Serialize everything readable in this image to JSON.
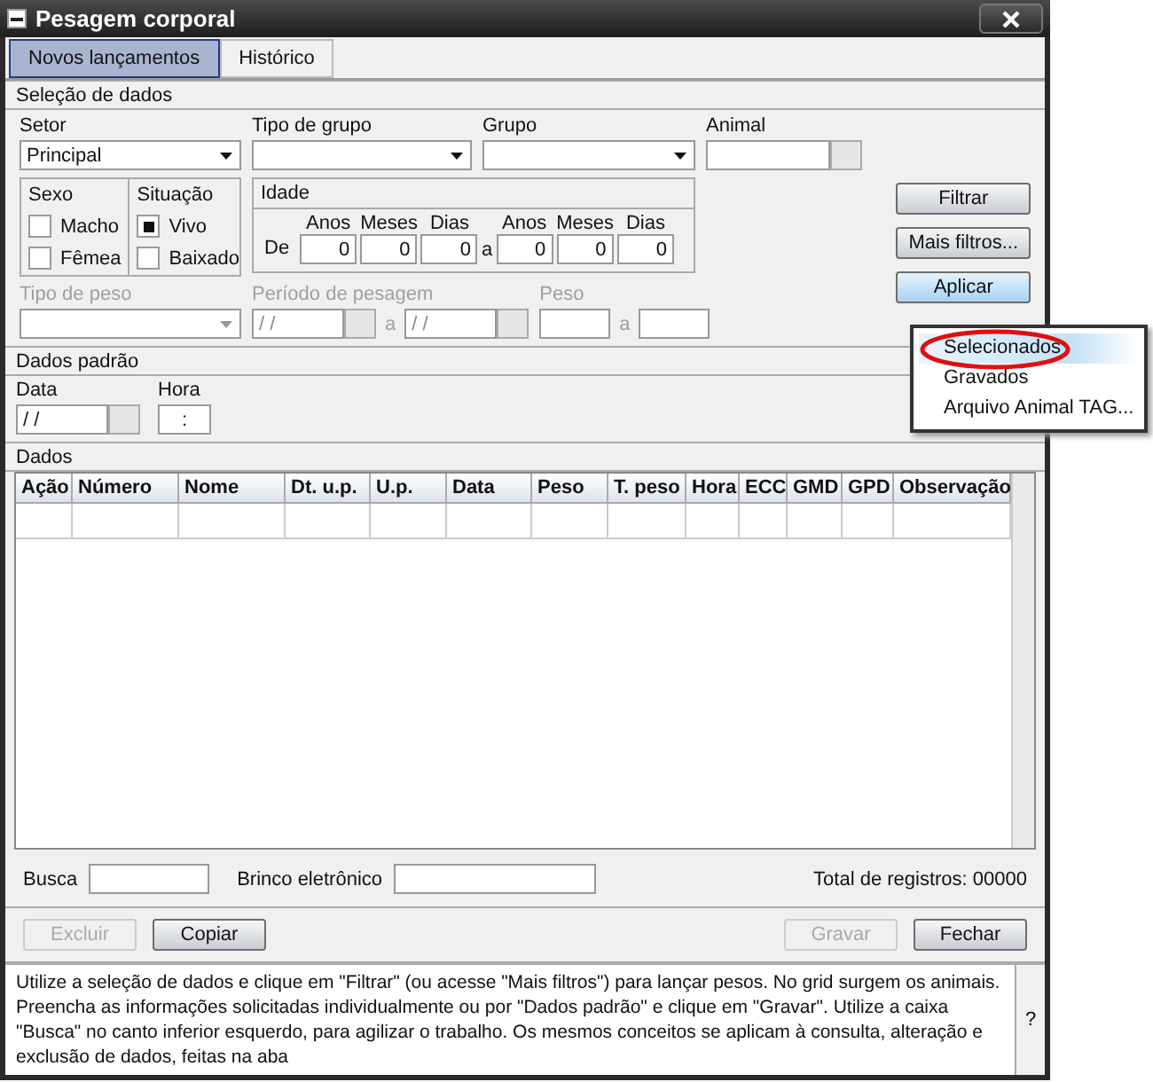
{
  "window": {
    "title": "Pesagem corporal"
  },
  "tabs": [
    {
      "label": "Novos lançamentos",
      "selected": true
    },
    {
      "label": "Histórico",
      "selected": false
    }
  ],
  "selection": {
    "title": "Seleção de dados",
    "setor": {
      "label": "Setor",
      "value": "Principal"
    },
    "tipo_grupo": {
      "label": "Tipo de grupo"
    },
    "grupo": {
      "label": "Grupo"
    },
    "animal": {
      "label": "Animal"
    },
    "sexo": {
      "title": "Sexo",
      "options": [
        {
          "label": "Macho",
          "checked": false
        },
        {
          "label": "Fêmea",
          "checked": false
        }
      ]
    },
    "situacao": {
      "title": "Situação",
      "options": [
        {
          "label": "Vivo",
          "checked": true
        },
        {
          "label": "Baixado",
          "checked": false
        }
      ]
    },
    "idade": {
      "title": "Idade",
      "from_label": "De",
      "to_label": "a",
      "from": [
        {
          "unit": "Anos",
          "value": "0"
        },
        {
          "unit": "Meses",
          "value": "0"
        },
        {
          "unit": "Dias",
          "value": "0"
        }
      ],
      "to": [
        {
          "unit": "Anos",
          "value": "0"
        },
        {
          "unit": "Meses",
          "value": "0"
        },
        {
          "unit": "Dias",
          "value": "0"
        }
      ]
    },
    "tipo_peso": {
      "label": "Tipo de peso",
      "disabled": true
    },
    "periodo": {
      "label": "Período de pesagem",
      "from": "/ /",
      "sep": "a",
      "to": "/ /",
      "disabled": true
    },
    "peso": {
      "label": "Peso",
      "sep": "a",
      "disabled": true
    }
  },
  "actions": [
    {
      "label": "Filtrar",
      "pressed": false
    },
    {
      "label": "Mais filtros...",
      "pressed": false
    },
    {
      "label": "Aplicar",
      "pressed": true
    }
  ],
  "menu": [
    {
      "label": "Selecionados",
      "selected": true
    },
    {
      "label": "Gravados",
      "selected": false
    },
    {
      "label": "Arquivo Animal TAG...",
      "selected": false
    }
  ],
  "dados_padrao": {
    "title": "Dados padrão",
    "data": {
      "label": "Data",
      "value": "/ /"
    },
    "hora": {
      "label": "Hora",
      "value": ":"
    }
  },
  "dados": {
    "title": "Dados",
    "columns": [
      "Ação",
      "Número",
      "Nome",
      "Dt. u.p.",
      "U.p.",
      "Data",
      "Peso",
      "T. peso",
      "Hora",
      "ECC",
      "GMD",
      "GPD",
      "Observação"
    ]
  },
  "busca": {
    "label": "Busca"
  },
  "brinco": {
    "label": "Brinco eletrônico"
  },
  "total": "Total de registros: 00000",
  "buttons": [
    {
      "label": "Excluir",
      "disabled": true
    },
    {
      "label": "Copiar",
      "disabled": false
    },
    {
      "label": "Gravar",
      "disabled": true
    },
    {
      "label": "Fechar",
      "disabled": false
    }
  ],
  "help": {
    "text": "Utilize a seleção de dados e clique em \"Filtrar\" (ou acesse \"Mais filtros\") para lançar pesos. No grid surgem os animais. Preencha as informações solicitadas individualmente ou por \"Dados padrão\" e clique em  \"Gravar\". Utilize a caixa \"Busca\" no canto inferior esquerdo, para agilizar o trabalho. Os mesmos conceitos se aplicam à consulta, alteração e exclusão de dados, feitas na aba",
    "button": "?"
  }
}
